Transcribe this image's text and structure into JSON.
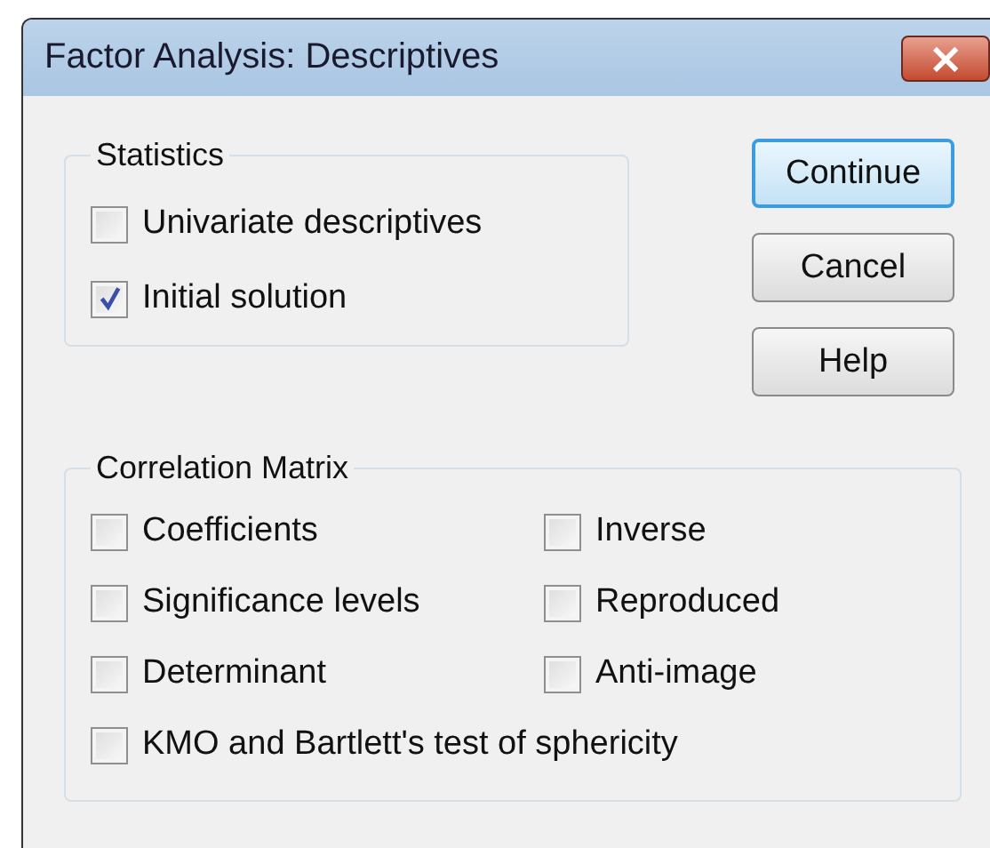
{
  "window": {
    "title": "Factor Analysis: Descriptives",
    "close": "×"
  },
  "groups": [
    {
      "title": "Statistics",
      "rows": [
        [
          {
            "label": "Univariate descriptives",
            "checked": false
          }
        ],
        [
          {
            "label": "Initial solution",
            "checked": true
          }
        ]
      ]
    },
    {
      "title": "Correlation Matrix",
      "rows": [
        [
          {
            "label": "Coefficients",
            "checked": false
          },
          {
            "label": "Inverse",
            "checked": false
          }
        ],
        [
          {
            "label": "Significance levels",
            "checked": false
          },
          {
            "label": "Reproduced",
            "checked": false
          }
        ],
        [
          {
            "label": "Determinant",
            "checked": false
          },
          {
            "label": "Anti-image",
            "checked": false
          }
        ],
        [
          {
            "label": "KMO and Bartlett's test of sphericity",
            "checked": false
          }
        ]
      ]
    }
  ],
  "buttons": [
    {
      "label": "Continue",
      "default": true
    },
    {
      "label": "Cancel",
      "default": false
    },
    {
      "label": "Help",
      "default": false
    }
  ]
}
